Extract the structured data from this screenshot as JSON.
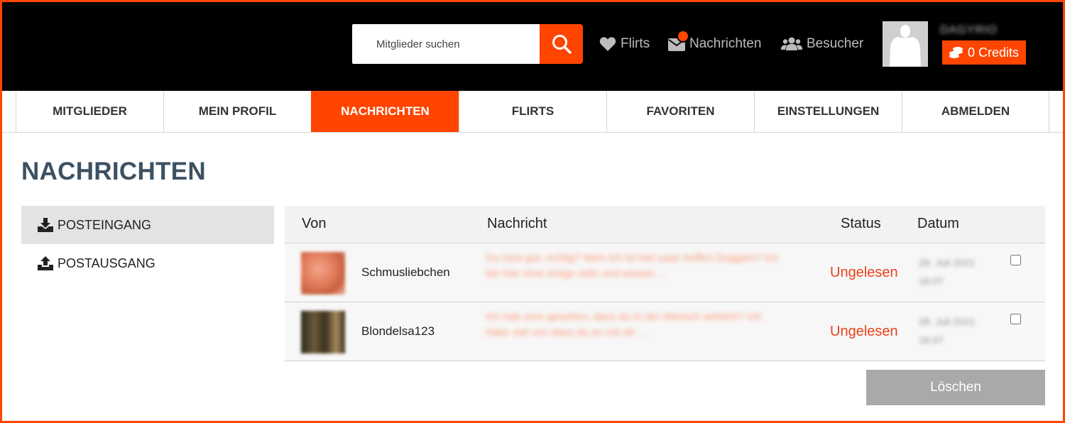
{
  "header": {
    "search_placeholder": "Mitglieder suchen",
    "links": {
      "flirts": "Flirts",
      "nachrichten": "Nachrichten",
      "besucher": "Besucher"
    },
    "username": "DAGYRIO",
    "credits": "0 Credits"
  },
  "tabs": [
    "MITGLIEDER",
    "MEIN PROFIL",
    "NACHRICHTEN",
    "FLIRTS",
    "FAVORITEN",
    "EINSTELLUNGEN",
    "ABMELDEN"
  ],
  "active_tab": "NACHRICHTEN",
  "page_title": "NACHRICHTEN",
  "sidebar": {
    "inbox": "POSTEINGANG",
    "outbox": "POSTAUSGANG"
  },
  "table": {
    "headers": {
      "from": "Von",
      "message": "Nachricht",
      "status": "Status",
      "date": "Datum"
    },
    "rows": [
      {
        "sender": "Schmusliebchen",
        "message": "Du hast gut, richtig? Nein ich ist hier paar treffen Doggies? Ich bin hier eine einige sehr und wissen ...",
        "status": "Ungelesen",
        "date": "28. Juli 2021 16:07"
      },
      {
        "sender": "Blondelsa123",
        "message": "Ich hab eine gesehen, dass du in der Mensch wirklich? Ich habe viel von dass du es mit dir ...",
        "status": "Ungelesen",
        "date": "28. Juli 2021 16:07"
      }
    ]
  },
  "delete_label": "Löschen",
  "colors": {
    "accent": "#ff4500",
    "title": "#3c5162",
    "status_unread": "#e8431b"
  }
}
